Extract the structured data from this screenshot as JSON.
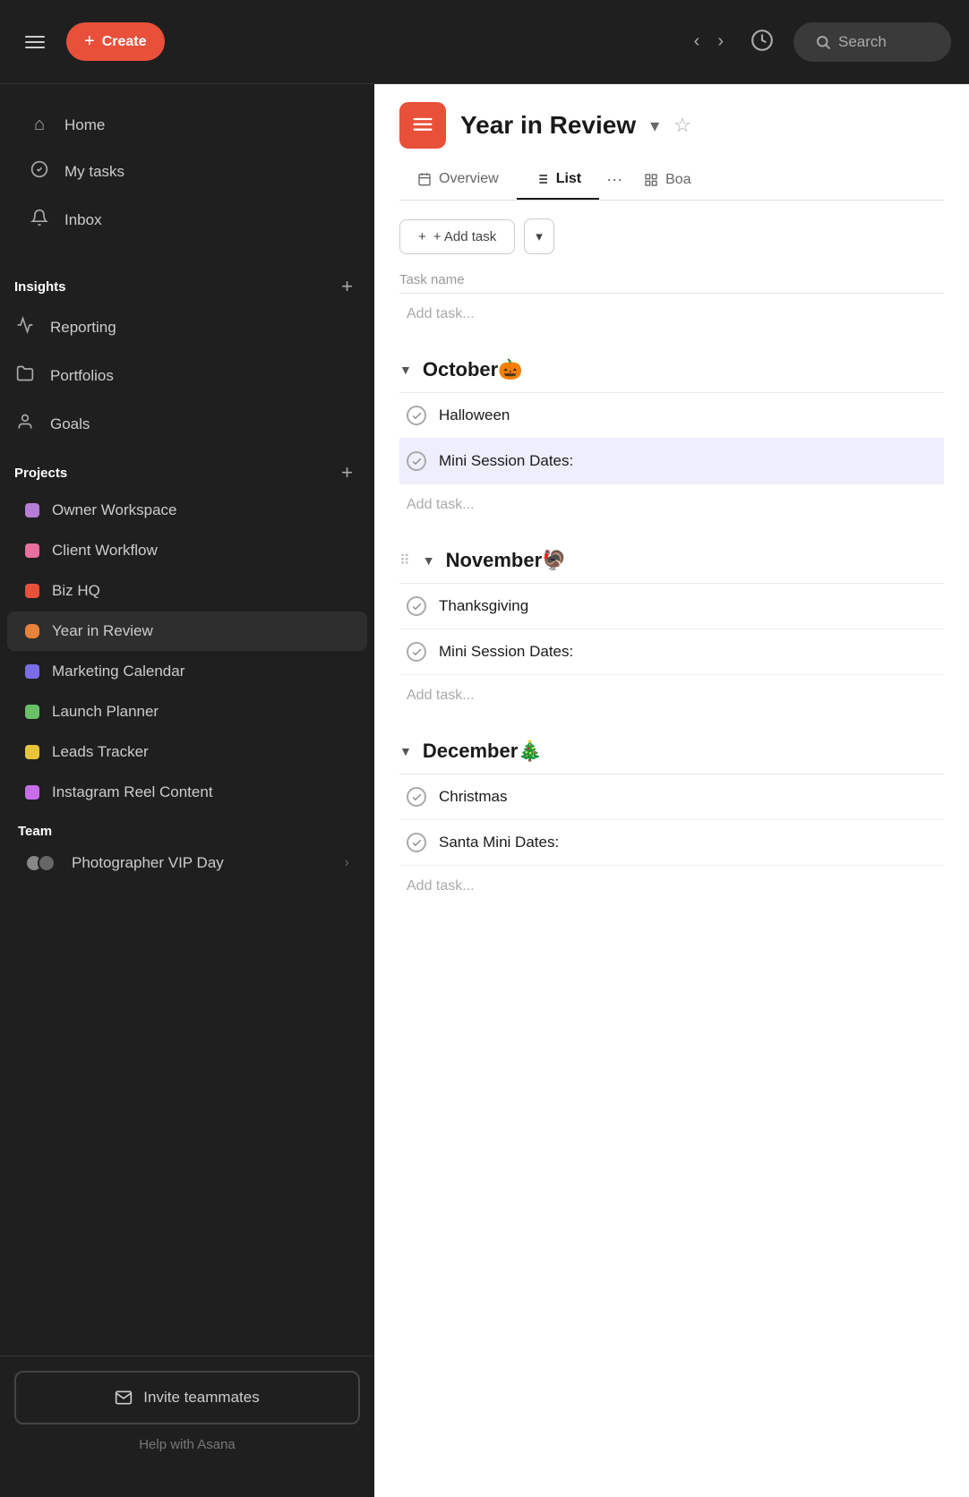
{
  "topNav": {
    "create_label": "Create",
    "search_label": "Search",
    "back_arrow": "‹",
    "forward_arrow": "›"
  },
  "sidebar": {
    "nav_items": [
      {
        "id": "home",
        "label": "Home",
        "icon": "⌂"
      },
      {
        "id": "my-tasks",
        "label": "My tasks",
        "icon": "○"
      },
      {
        "id": "inbox",
        "label": "Inbox",
        "icon": "🔔"
      }
    ],
    "insights_label": "Insights",
    "insights_items": [
      {
        "id": "reporting",
        "label": "Reporting",
        "icon": "📈"
      },
      {
        "id": "portfolios",
        "label": "Portfolios",
        "icon": "📁"
      },
      {
        "id": "goals",
        "label": "Goals",
        "icon": "👤"
      }
    ],
    "projects_label": "Projects",
    "projects": [
      {
        "id": "owner-workspace",
        "label": "Owner Workspace",
        "color": "#b67dd6"
      },
      {
        "id": "client-workflow",
        "label": "Client Workflow",
        "color": "#e86fa0"
      },
      {
        "id": "biz-hq",
        "label": "Biz HQ",
        "color": "#e8503a"
      },
      {
        "id": "year-in-review",
        "label": "Year in Review",
        "color": "#e8823a",
        "active": true
      },
      {
        "id": "marketing-calendar",
        "label": "Marketing Calendar",
        "color": "#7b6de8"
      },
      {
        "id": "launch-planner",
        "label": "Launch Planner",
        "color": "#6abf69"
      },
      {
        "id": "leads-tracker",
        "label": "Leads Tracker",
        "color": "#e8c43a"
      },
      {
        "id": "instagram-reel-content",
        "label": "Instagram Reel Content",
        "color": "#c86de8"
      }
    ],
    "team_label": "Team",
    "team_items": [
      {
        "id": "photographer-vip-day",
        "label": "Photographer VIP Day"
      }
    ],
    "invite_label": "Invite teammates",
    "help_label": "Help with Asana"
  },
  "project": {
    "title": "Year in Review",
    "icon": "≡",
    "tabs": [
      {
        "id": "overview",
        "label": "Overview",
        "icon": "📅",
        "active": false
      },
      {
        "id": "list",
        "label": "List",
        "icon": "☰",
        "active": true
      },
      {
        "id": "board",
        "label": "Boa",
        "icon": "⊞",
        "active": false
      }
    ],
    "add_task_label": "+ Add task",
    "task_name_header": "Task name",
    "sections": [
      {
        "id": "october",
        "title": "October🎃",
        "tasks": [
          {
            "id": "halloween",
            "label": "Halloween",
            "highlighted": false
          },
          {
            "id": "mini-session-oct",
            "label": "Mini Session Dates:",
            "highlighted": true
          }
        ]
      },
      {
        "id": "november",
        "title": "November🦃",
        "tasks": [
          {
            "id": "thanksgiving",
            "label": "Thanksgiving",
            "highlighted": false
          },
          {
            "id": "mini-session-nov",
            "label": "Mini Session Dates:",
            "highlighted": false
          }
        ]
      },
      {
        "id": "december",
        "title": "December🎄",
        "tasks": [
          {
            "id": "christmas",
            "label": "Christmas",
            "highlighted": false
          },
          {
            "id": "santa-mini-dates",
            "label": "Santa Mini Dates:",
            "highlighted": false
          }
        ]
      }
    ]
  }
}
